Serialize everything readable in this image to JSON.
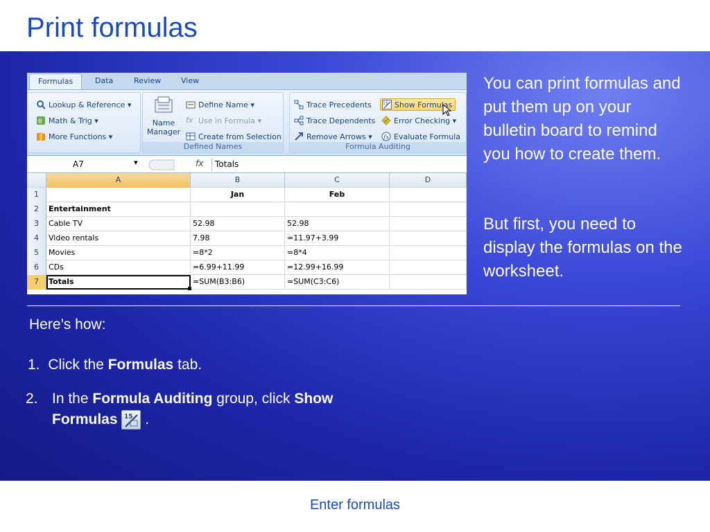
{
  "slide": {
    "title": "Print formulas",
    "footer": "Enter formulas"
  },
  "excel": {
    "tabs": [
      "Formulas",
      "Data",
      "Review",
      "View"
    ],
    "ribbon": {
      "lookup": "Lookup & Reference",
      "math": "Math & Trig",
      "more": "More Functions",
      "name_manager_line1": "Name",
      "name_manager_line2": "Manager",
      "define_name": "Define Name",
      "use_in_formula": "Use in Formula",
      "create_from_selection": "Create from Selection",
      "defined_names_caption": "Defined Names",
      "trace_precedents": "Trace Precedents",
      "trace_dependents": "Trace Dependents",
      "remove_arrows": "Remove Arrows",
      "show_formulas": "Show Formulas",
      "error_checking": "Error Checking",
      "evaluate_formula": "Evaluate Formula",
      "formula_auditing_caption": "Formula Auditing",
      "dropdown_arrow": "▾"
    },
    "formula_bar": {
      "name_box": "A7",
      "fx": "fx",
      "value": "Totals"
    },
    "columns": [
      "A",
      "B",
      "C",
      "D"
    ],
    "rows": [
      {
        "num": "1",
        "a": "",
        "b": "Jan",
        "c": "Feb",
        "d": ""
      },
      {
        "num": "2",
        "a": "Entertainment",
        "b": "",
        "c": "",
        "d": ""
      },
      {
        "num": "3",
        "a": "Cable TV",
        "b": "52.98",
        "c": "52.98",
        "d": ""
      },
      {
        "num": "4",
        "a": "Video rentals",
        "b": "7.98",
        "c": "=11.97+3.99",
        "d": ""
      },
      {
        "num": "5",
        "a": "Movies",
        "b": "=8*2",
        "c": "=8*4",
        "d": ""
      },
      {
        "num": "6",
        "a": "CDs",
        "b": "=6.99+11.99",
        "c": "=12.99+16.99",
        "d": ""
      },
      {
        "num": "7",
        "a": "Totals",
        "b": "=SUM(B3:B6)",
        "c": "=SUM(C3:C6)",
        "d": ""
      }
    ]
  },
  "side": {
    "para1": "You can print formulas and put them up on your bulletin board to remind you how to create them.",
    "para2": "But first, you need to display the formulas on the worksheet."
  },
  "howto": {
    "heading": "Here’s how:",
    "step1_num": "1.",
    "step1_pre": "Click the ",
    "step1_bold": "Formulas",
    "step1_post": " tab.",
    "step2_num": "2.",
    "step2_pre": "In the ",
    "step2_bold1": "Formula Auditing",
    "step2_mid": " group, click ",
    "step2_bold2a": "Show",
    "step2_bold2b": "Formulas",
    "step2_end": "."
  }
}
